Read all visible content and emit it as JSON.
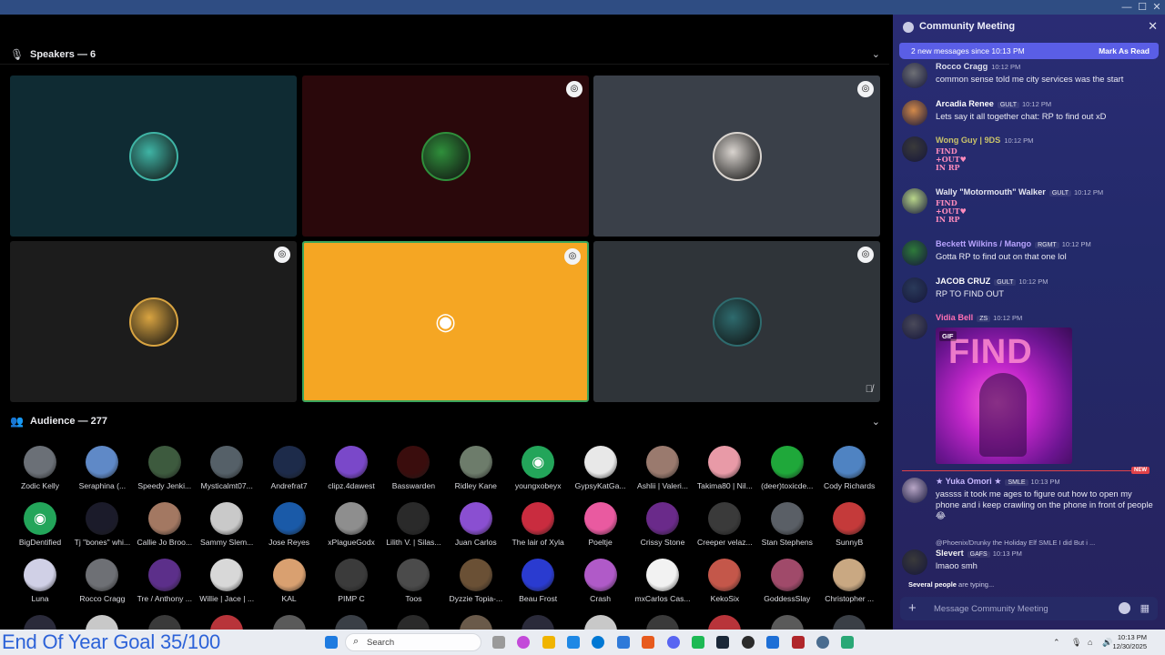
{
  "window": {
    "controls": [
      "—",
      "☐",
      "✕"
    ]
  },
  "speakers_header": {
    "label": "Speakers — 6"
  },
  "audience_header": {
    "label": "Audience — 277"
  },
  "speaker_tiles": [
    {
      "bg": "#0f2b33",
      "avatar": "#3fb4a5",
      "badge": false
    },
    {
      "bg": "#2a080b",
      "avatar": "#2f8f3b",
      "badge": true
    },
    {
      "bg": "#3a4049",
      "avatar": "#d9d4cf",
      "badge": true
    },
    {
      "bg": "#1c1c1c",
      "avatar": "#d9a441",
      "badge": true
    },
    {
      "bg": "#f5a623",
      "avatar": "#ffffff",
      "badge": true,
      "discord": true,
      "active": true
    },
    {
      "bg": "#2f3439",
      "avatar": "#2e6b6e",
      "badge": true,
      "muted": true
    }
  ],
  "audience": [
    {
      "name": "Zodic Kelly",
      "color": "#6b7077"
    },
    {
      "name": "Seraphina (...",
      "color": "#5f89c7"
    },
    {
      "name": "Speedy Jenki...",
      "color": "#3d5a3e"
    },
    {
      "name": "Mysticalmt07...",
      "color": "#556068"
    },
    {
      "name": "Andrefrat7",
      "color": "#1d2b4a"
    },
    {
      "name": "clipz.4dawest",
      "color": "#7a48c9"
    },
    {
      "name": "Basswarden",
      "color": "#3a0d0d"
    },
    {
      "name": "Ridley Kane",
      "color": "#6d7c6b"
    },
    {
      "name": "youngxobeyx",
      "color": "#23a55a",
      "discord": true
    },
    {
      "name": "GypsyKatGa...",
      "color": "#e8e8e8"
    },
    {
      "name": "Ashlii | Valeri...",
      "color": "#9a7a6e"
    },
    {
      "name": "Takima80 | Nil...",
      "color": "#e89aa7"
    },
    {
      "name": "(deer)toxicde...",
      "color": "#1fa83a"
    },
    {
      "name": "Cody Richards",
      "color": "#4f83c2"
    },
    {
      "name": "BigDentified",
      "color": "#23a55a",
      "discord": true
    },
    {
      "name": "Tj \"bones\" whi...",
      "color": "#1b1b2a"
    },
    {
      "name": "Callie Jo Broo...",
      "color": "#a37862"
    },
    {
      "name": "Sammy Slem...",
      "color": "#c9c9c9"
    },
    {
      "name": "Jose Reyes",
      "color": "#1a5aa8"
    },
    {
      "name": "xPlagueGodx",
      "color": "#8e8e8e"
    },
    {
      "name": "Lilith V. | Silas...",
      "color": "#2a2a2a"
    },
    {
      "name": "Juan Carlos",
      "color": "#8a4fd1"
    },
    {
      "name": "The lair of Xyla",
      "color": "#c92c3f"
    },
    {
      "name": "Poeltje",
      "color": "#e95aa0"
    },
    {
      "name": "Crissy Stone",
      "color": "#6a2a8a"
    },
    {
      "name": "Creeper velaz...",
      "color": "#3a3a3a"
    },
    {
      "name": "Stan Stephens",
      "color": "#5a5f66"
    },
    {
      "name": "SunnyB",
      "color": "#c43a3a"
    },
    {
      "name": "Luna",
      "color": "#d0d0e6"
    },
    {
      "name": "Rocco Cragg",
      "color": "#6e7075"
    },
    {
      "name": "Tre / Anthony ...",
      "color": "#5c2f8a"
    },
    {
      "name": "Willie | Jace | ...",
      "color": "#d8d8d8"
    },
    {
      "name": "KAL",
      "color": "#d9a070"
    },
    {
      "name": "PIMP C",
      "color": "#3b3b3b"
    },
    {
      "name": "Toos",
      "color": "#4b4b4b"
    },
    {
      "name": "Dyzzie Topia-...",
      "color": "#6a5035"
    },
    {
      "name": "Beau Frost",
      "color": "#2a3bd0"
    },
    {
      "name": "Crash",
      "color": "#b05ac8"
    },
    {
      "name": "mxCarlos Cas...",
      "color": "#f2f2f2"
    },
    {
      "name": "KekoSix",
      "color": "#c4574a"
    },
    {
      "name": "GoddessSlay",
      "color": "#a04a6a"
    },
    {
      "name": "Christopher ...",
      "color": "#c9a882"
    }
  ],
  "goal_text": "End Of Year Goal 35/100",
  "chat": {
    "title": "Community Meeting",
    "new_messages": "2 new messages since 10:13 PM",
    "mark_read": "Mark As Read",
    "messages": [
      {
        "author": "Rocco Cragg",
        "author_color": "#dfe1ee",
        "tag": "",
        "time": "10:12 PM",
        "text": "common sense told me city services was the start",
        "avatar": "#6e7075"
      },
      {
        "author": "Arcadia Renee",
        "author_color": "#ffffff",
        "tag": "GULT",
        "time": "10:12 PM",
        "text": "Lets say it all together chat: RP to find out xD",
        "avatar": "#d38a4a"
      },
      {
        "author": "Wong Guy | 9DS",
        "author_color": "#c9c36a",
        "tag": "",
        "time": "10:12 PM",
        "sticker": "FIND\n+OUT♥\nIN RP",
        "avatar": "#3a3a3a"
      },
      {
        "author": "Wally \"Motormouth\" Walker",
        "author_color": "#e6e7f2",
        "tag": "GULT",
        "time": "10:12 PM",
        "sticker": "FIND\n+OUT♥\nIN RP",
        "avatar": "#b9d68a"
      },
      {
        "author": "Beckett Wilkins / Mango",
        "author_color": "#b9a4ff",
        "tag": "RGMT",
        "time": "10:12 PM",
        "text": "Gotta RP to find out on that one lol",
        "avatar": "#2e7a3a"
      },
      {
        "author": "JACOB CRUZ",
        "author_color": "#ffffff",
        "tag": "GULT",
        "time": "10:12 PM",
        "text": "RP TO FIND OUT",
        "avatar": "#2a3a5a"
      },
      {
        "author": "Vidia Bell",
        "author_color": "#ff6fb3",
        "tag": "ZS",
        "time": "10:12 PM",
        "gif": "GIF",
        "gif_text": "FIND",
        "avatar": "#4a4a5a"
      },
      {
        "author": "★ Yuka Omori ★",
        "author_color": "#c7b8ff",
        "tag": "SMLE",
        "time": "10:13 PM",
        "text": "yassss it took me ages to figure out how to open my phone and i keep crawling on the phone in front of people😂",
        "avatar": "#b8a6c6"
      },
      {
        "author": "Slevert",
        "author_color": "#f2f2f2",
        "tag": "GAFS",
        "time": "10:13 PM",
        "text": "lmaoo smh",
        "reply": "@Phoenix/Drunky the Holiday Elf  SMLE  I did But i ...",
        "avatar": "#3a3a3a"
      }
    ],
    "new_tag": "NEW",
    "typing": {
      "who": "Several people",
      "rest": " are typing..."
    },
    "composer_placeholder": "Message Community Meeting"
  },
  "taskbar": {
    "search_label": "Search",
    "clock_time": "10:13 PM",
    "clock_date": "12/30/2025",
    "pinned": [
      "#0a64d6",
      "#e7b14a",
      "#9a9a9a",
      "#c34ad9",
      "#f0b400",
      "#1e88e5",
      "#0078d4",
      "#2f7ad9",
      "#e75b1e",
      "#5865f2",
      "#1db954",
      "#1b2838",
      "#2b2b2b",
      "#1e6fd6",
      "#b0262b",
      "#4a6c8f",
      "#2aa876"
    ]
  }
}
